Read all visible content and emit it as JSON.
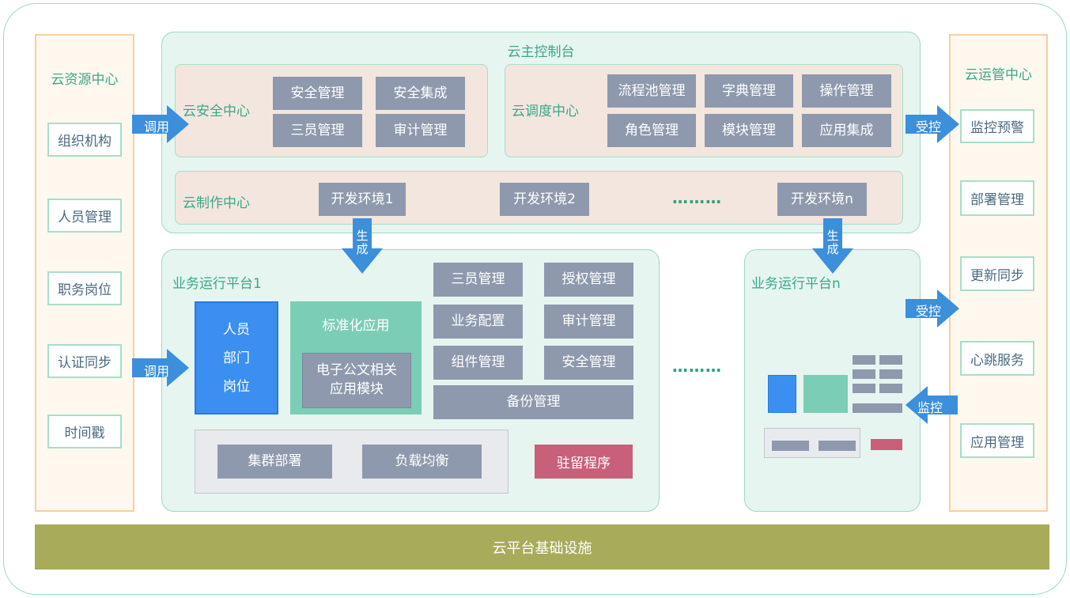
{
  "left_column": {
    "title": "云资源中心",
    "items": [
      "组织机构",
      "人员管理",
      "职务岗位",
      "认证同步",
      "时间戳"
    ]
  },
  "right_column": {
    "title": "云运管中心",
    "items": [
      "监控预警",
      "部署管理",
      "更新同步",
      "心跳服务",
      "应用管理"
    ]
  },
  "console": {
    "title": "云主控制台",
    "security": {
      "title": "云安全中心",
      "items": [
        "安全管理",
        "安全集成",
        "三员管理",
        "审计管理"
      ]
    },
    "dispatch": {
      "title": "云调度中心",
      "items": [
        "流程池管理",
        "字典管理",
        "操作管理",
        "角色管理",
        "模块管理",
        "应用集成"
      ]
    },
    "production": {
      "title": "云制作中心",
      "envs": [
        "开发环境1",
        "开发环境2",
        "开发环境n"
      ],
      "ellipsis": "………"
    }
  },
  "platform1": {
    "title": "业务运行平台1",
    "org_lines": [
      "人员",
      "部门",
      "岗位"
    ],
    "std_app": {
      "title": "标准化应用",
      "module": "电子公文相关\n应用模块"
    },
    "manage_items": [
      "三员管理",
      "授权管理",
      "业务配置",
      "审计管理",
      "组件管理",
      "安全管理"
    ],
    "backup": "备份管理",
    "cluster_items": [
      "集群部署",
      "负载均衡"
    ],
    "resident": "驻留程序"
  },
  "platform_n": {
    "title": "业务运行平台n"
  },
  "middle_ellipsis": "………",
  "arrows": {
    "call_1": "调用",
    "call_2": "调用",
    "controlled_1": "受控",
    "controlled_2": "受控",
    "monitor": "监控",
    "generate_1": "生成",
    "generate_2": "生成"
  },
  "infrastructure": "云平台基础设施",
  "colors": {
    "green_title": "#3aa78a",
    "arrow_blue": "#3b8fdb",
    "module_grey": "#8e99ad",
    "resident_red": "#c86079",
    "infra_olive": "#a8ab5a"
  }
}
